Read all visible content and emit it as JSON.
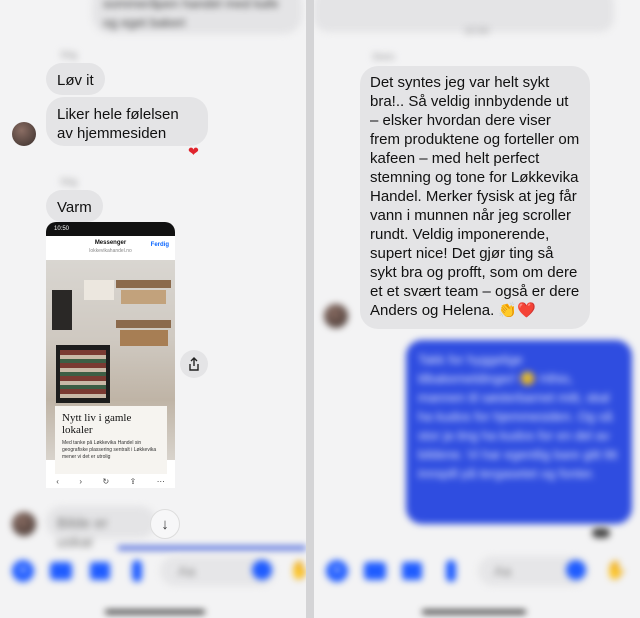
{
  "left": {
    "top_bubble_text": "sommeråpen handel med kafe og eget bakeri",
    "sender_1": "Stig",
    "msg_love": "Løv it",
    "msg_likes": "Liker hele følelsen av hjemmesiden",
    "sender_2": "Stig",
    "msg_warm": "Varm",
    "screenshot": {
      "time": "10:50",
      "app": "Messenger",
      "url": "lokkevikahandel.no",
      "done": "Ferdig",
      "card_title": "Nytt liv i gamle lokaler",
      "card_body": "Med tanke på Løkkevika Handel sin geografiske plassering sentralt i Løkkevika mener vi det er utrolig",
      "nav": [
        "‹",
        "›",
        "↻",
        "⇪",
        "⋯"
      ]
    },
    "input_placeholder": "Bilde er uskar",
    "composer_placeholder": "Aa"
  },
  "right": {
    "timestamp": "10:50",
    "sender": "Stein",
    "msg_main": "Det syntes jeg var helt sykt bra!.. Så veldig innbydende ut – elsker hvordan dere viser frem produktene og forteller om kafeen – med helt perfect stemning og tone for Løkkevika Handel. Merker fysisk at jeg får vann i munnen når jeg scroller rundt. Veldig imponerende, supert nice! Det gjør ting så sykt bra og profft, som om dere et et svært team – også er dere Anders og Helena. 👏❤️",
    "msg_blue": "Takk for hyggelige tilbakemeldinger! 😊 Hihio, mannen til søsterbarnet mitt, skal ha kudos for hjemmesiden. Og så stor ja ting ha kudos for en del av bildene. Vi har egentlig bare gitt litt innspill på tergasetet og fonter.",
    "composer_placeholder": "Aa"
  },
  "colors": {
    "accent": "#0a66ff",
    "bubble_gray": "#e4e4e6",
    "heart": "#e0242d",
    "blue_bubble": "#2f4de0"
  }
}
